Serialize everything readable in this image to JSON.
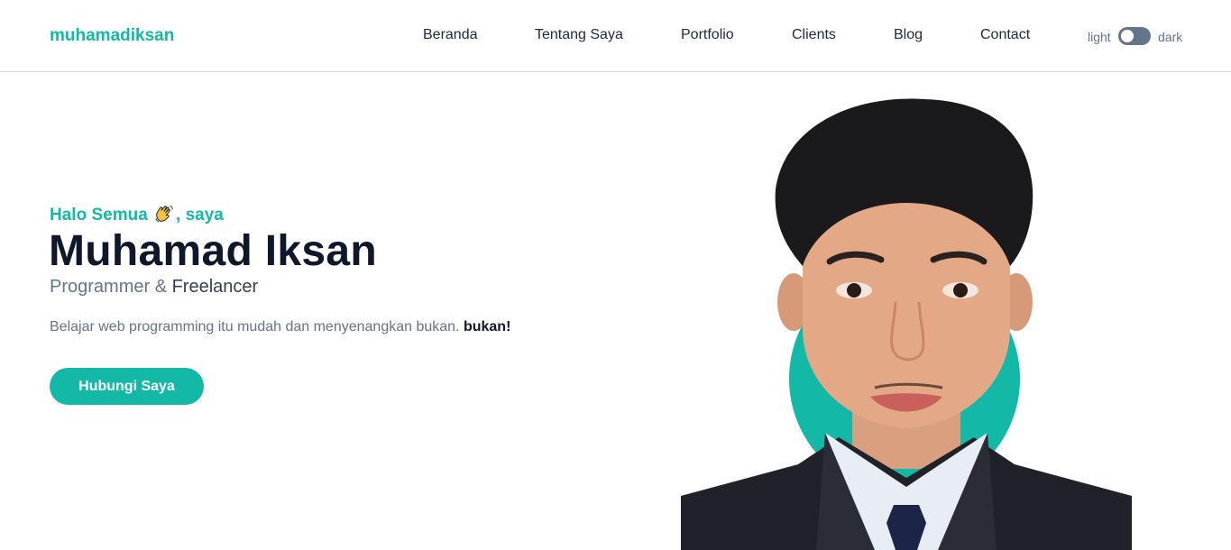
{
  "header": {
    "logo": "muhamadiksan",
    "nav": [
      {
        "label": "Beranda"
      },
      {
        "label": "Tentang Saya"
      },
      {
        "label": "Portfolio"
      },
      {
        "label": "Clients"
      },
      {
        "label": "Blog"
      },
      {
        "label": "Contact"
      }
    ],
    "theme_toggle": {
      "light_label": "light",
      "dark_label": "dark"
    }
  },
  "hero": {
    "greeting_before": "Halo Semua",
    "greeting_after": ", saya",
    "name": "Muhamad Iksan",
    "role_primary": "Programmer &",
    "role_secondary": "Freelancer",
    "description": "Belajar web programming itu mudah dan menyenangkan bukan.",
    "description_bold": "bukan!",
    "cta_label": "Hubungi Saya"
  },
  "colors": {
    "accent": "#14b8a6",
    "heading": "#0f172a",
    "muted": "#64748b"
  },
  "icons": {
    "greeting": "waving-hand-icon",
    "toggle": "theme-toggle-switch"
  }
}
